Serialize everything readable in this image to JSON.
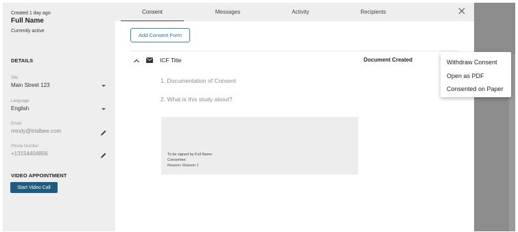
{
  "participant": {
    "created": "Created 1 day ago",
    "name": "Full Name",
    "status": "Currently active"
  },
  "details": {
    "title": "DETAILS",
    "site": {
      "label": "Site",
      "value": "Main Street 123"
    },
    "language": {
      "label": "Language",
      "value": "English"
    },
    "email": {
      "label": "Email",
      "value": "mindy@trialbee.com"
    },
    "phone": {
      "label": "Phone Number",
      "value": "+13154404856"
    }
  },
  "video": {
    "title": "VIDEO APPOINTMENT",
    "button": "Start Video Call"
  },
  "tabs": {
    "consent": "Consent",
    "messages": "Messages",
    "activity": "Activity",
    "recipients": "Recipients"
  },
  "consent": {
    "add_button": "Add Consent Form",
    "form_title": "ICF Title",
    "form_status": "Document Created",
    "questions": [
      "1. Documentation of Consent",
      "2. What is this study about?"
    ],
    "preview": {
      "line1": "To be signed by Full Name",
      "line2": "Consentee",
      "line3": "Reason: Reason 1"
    }
  },
  "menu": {
    "items": [
      "Withdraw Consent",
      "Open as PDF",
      "Consented on Paper"
    ]
  },
  "colors": {
    "accent": "#1f5d80",
    "link": "#2a6f99",
    "sidebar_bg": "#eeeeee",
    "overlay": "#8c8c8c"
  },
  "icons": [
    "edit-icon",
    "close-icon",
    "chevron-up-icon",
    "mail-icon",
    "caret-down-icon"
  ]
}
